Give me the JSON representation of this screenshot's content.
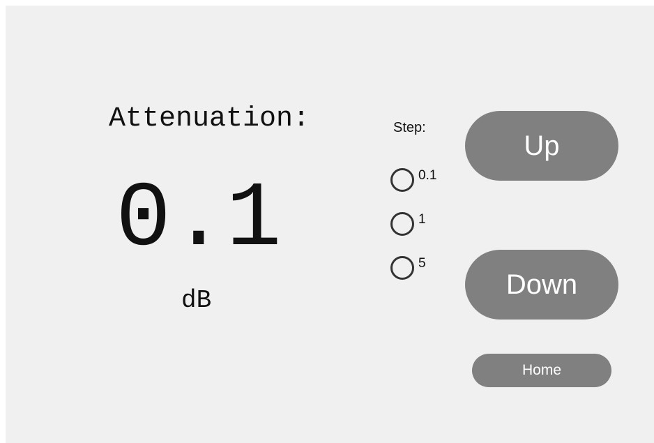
{
  "attenuation": {
    "title": "Attenuation:",
    "value": "0.1",
    "unit": "dB"
  },
  "step": {
    "label": "Step:",
    "options": [
      "0.1",
      "1",
      "5"
    ],
    "selected": null
  },
  "buttons": {
    "up_label": "Up",
    "down_label": "Down",
    "home_label": "Home"
  },
  "colors": {
    "background": "#f0f0f0",
    "button": "#808080",
    "button_text": "#ffffff",
    "text": "#111111"
  }
}
